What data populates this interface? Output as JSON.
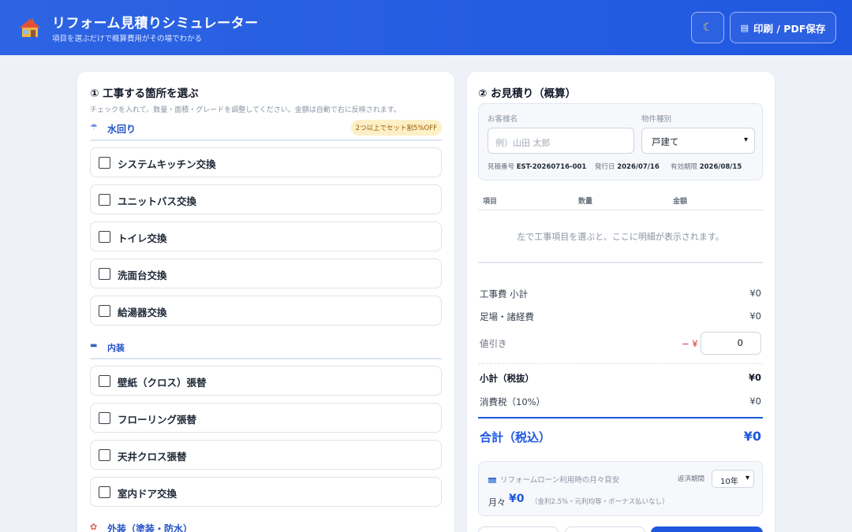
{
  "header": {
    "logo_icon": "house-icon",
    "title": "リフォーム見積りシミュレーター",
    "subtitle": "項目を選ぶだけで概算費用がその場でわかる",
    "dark_mode_icon": "moon-icon",
    "print_icon": "printer-icon",
    "print_label": "印刷 / PDF保存"
  },
  "left": {
    "title": "① 工事する箇所を選ぶ",
    "hint": "チェックを入れて、数量・面積・グレードを調整してください。金額は自動で右に反映されます。",
    "categories": [
      {
        "icon": "shower-icon",
        "label": "水回り",
        "badge": "2つ以上でセット割5%OFF",
        "items": [
          "システムキッチン交換",
          "ユニットバス交換",
          "トイレ交換",
          "洗面台交換",
          "給湯器交換"
        ]
      },
      {
        "icon": "sofa-icon",
        "label": "内装",
        "items": [
          "壁紙（クロス）張替",
          "フローリング張替",
          "天井クロス張替",
          "室内ドア交換"
        ]
      },
      {
        "icon": "palette-icon",
        "label": "外装（塗装・防水）"
      }
    ]
  },
  "right": {
    "title": "② お見積り（概算）",
    "customer_label": "お客様名",
    "customer_placeholder": "例）山田 太郎",
    "property_label": "物件種別",
    "property_value": "戸建て",
    "estimate_no_label": "見積番号",
    "estimate_no": "EST-20260716-001",
    "issue_label": "発行日",
    "issue_date": "2026/07/16",
    "valid_label": "有効期限",
    "valid_date": "2026/08/15",
    "table_headers": [
      "項目",
      "数量",
      "金額"
    ],
    "empty_message": "左で工事項目を選ぶと、ここに明細が表示されます。",
    "work_subtotal_label": "工事費 小計",
    "work_subtotal": "¥0",
    "scaffold_label": "足場・諸経費",
    "scaffold": "¥0",
    "discount_label": "値引き",
    "discount_sign": "− ¥",
    "discount_value": "0",
    "subtotal_label": "小計（税抜）",
    "subtotal": "¥0",
    "tax_label": "消費税（10%）",
    "tax": "¥0",
    "total_label": "合計（税込）",
    "total": "¥0",
    "loan": {
      "icon": "credit-card-icon",
      "title": "リフォームローン利用時の月々目安",
      "period_label": "返済期間",
      "period_value": "10年",
      "monthly_label": "月々",
      "monthly_value": "¥0",
      "note": "（金利2.5%・元利均等・ボーナス払いなし）"
    }
  }
}
